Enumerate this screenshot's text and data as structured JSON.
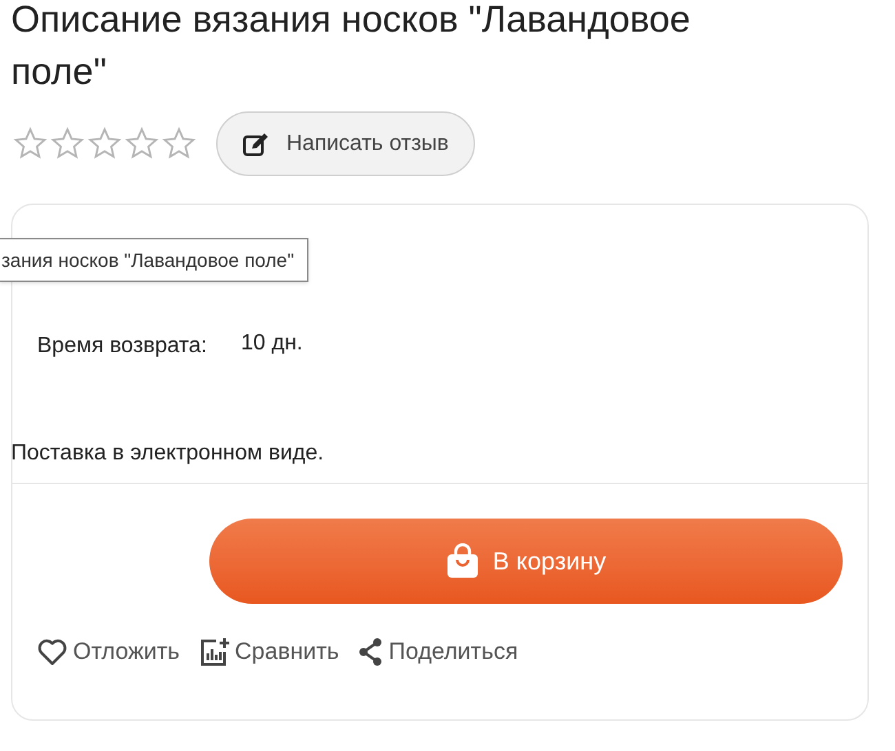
{
  "title": "Описание вязания носков \"Лавандовое поле\"",
  "rating": {
    "stars": 0
  },
  "review_button": "Написать отзыв",
  "tooltip": "зания носков \"Лавандовое поле\"",
  "return_label": "Время возврата:",
  "return_value": "10 дн.",
  "delivery": "Поставка в электронном виде.",
  "cart_button": "В корзину",
  "actions": [
    {
      "kind": "wishlist",
      "label": "Отложить"
    },
    {
      "kind": "compare",
      "label": "Сравнить"
    },
    {
      "kind": "share",
      "label": "Поделиться"
    }
  ]
}
